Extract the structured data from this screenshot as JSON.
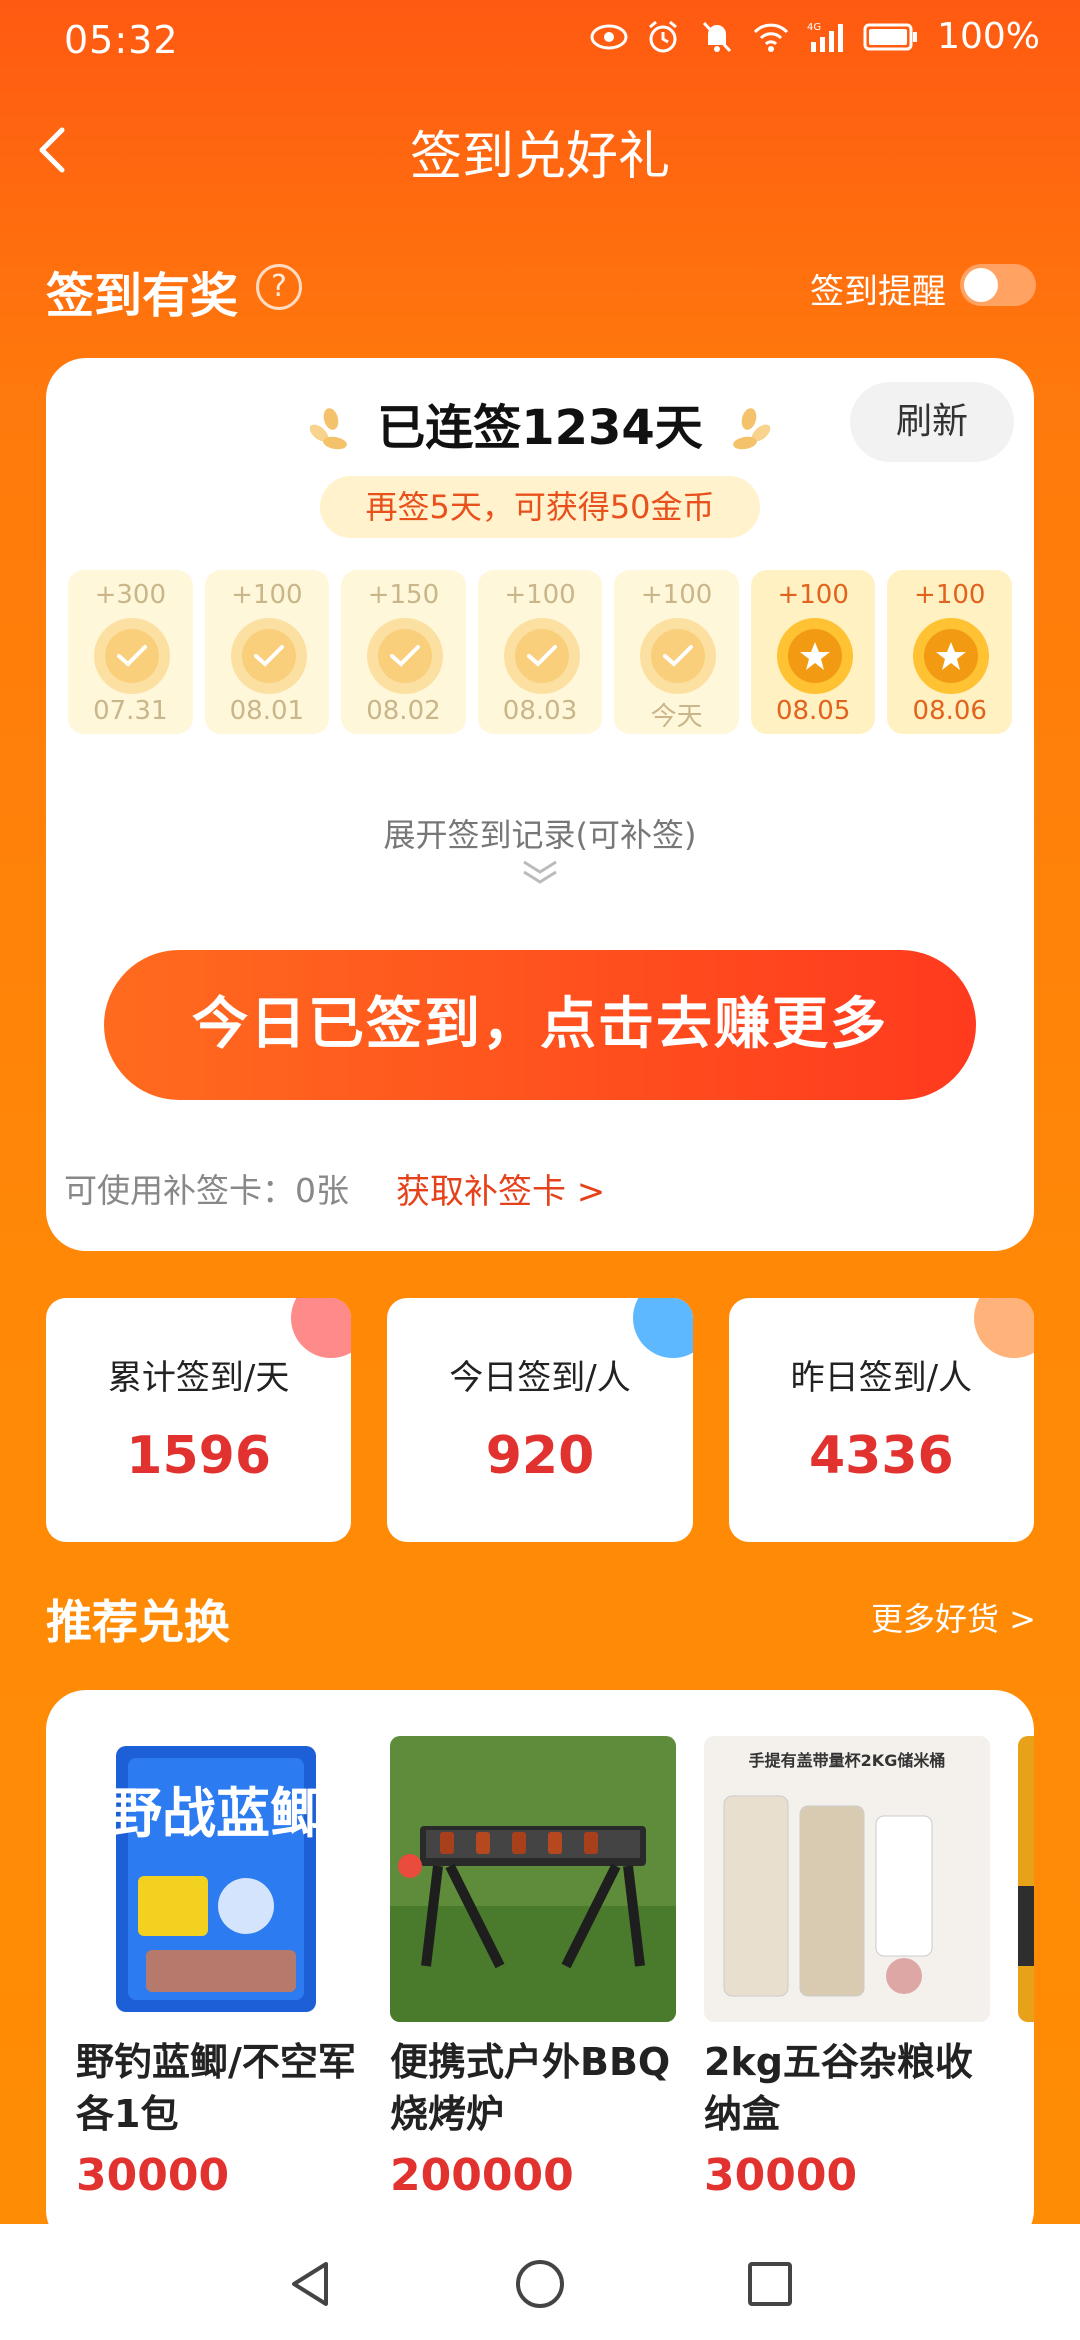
{
  "status_bar": {
    "time": "05:32",
    "battery": "100%",
    "network": "4G"
  },
  "header": {
    "title": "签到兑好礼"
  },
  "signin_section": {
    "title": "签到有奖",
    "help": "?",
    "reminder_label": "签到提醒",
    "reminder_on": false
  },
  "card": {
    "streak_text": "已连签1234天",
    "refresh_label": "刷新",
    "hint": "再签5天，可获得50金币",
    "days": [
      {
        "points": "+300",
        "date": "07.31",
        "state": "signed"
      },
      {
        "points": "+100",
        "date": "08.01",
        "state": "signed"
      },
      {
        "points": "+150",
        "date": "08.02",
        "state": "signed"
      },
      {
        "points": "+100",
        "date": "08.03",
        "state": "signed"
      },
      {
        "points": "+100",
        "date": "今天",
        "state": "signed"
      },
      {
        "points": "+100",
        "date": "08.05",
        "state": "future"
      },
      {
        "points": "+100",
        "date": "08.06",
        "state": "future"
      }
    ],
    "expand_label": "展开签到记录(可补签)",
    "cta_label": "今日已签到，点击去赚更多",
    "makeup_cards": "可使用补签卡：0张",
    "get_makeup_link": "获取补签卡 >"
  },
  "stats": [
    {
      "label": "累计签到/天",
      "value": "1596",
      "accent": "#FF8A8A"
    },
    {
      "label": "今日签到/人",
      "value": "920",
      "accent": "#5DB8FF"
    },
    {
      "label": "昨日签到/人",
      "value": "4336",
      "accent": "#FFB27A"
    }
  ],
  "recommend": {
    "title": "推荐兑换",
    "more_label": "更多好货 >",
    "products": [
      {
        "name": "野钓蓝鲫/不空军各1包",
        "price": "30000",
        "image_text": "野战蓝鲫"
      },
      {
        "name": "便携式户外BBQ烧烤炉",
        "price": "200000"
      },
      {
        "name": "2kg五谷杂粮收纳盒",
        "price": "30000",
        "image_text": "手提有盖带量杯2KG储米桶"
      }
    ]
  },
  "colors": {
    "accent_orange": "#FF7A0C",
    "price_red": "#E2322F",
    "cta_red": "#FF3A1E"
  },
  "icons": [
    "back-icon",
    "eye-icon",
    "alarm-icon",
    "mute-icon",
    "wifi-icon",
    "signal-icon",
    "battery-icon",
    "laurel-icon",
    "check-icon",
    "star-icon",
    "chevron-down-icon",
    "back-nav-icon",
    "home-nav-icon",
    "recents-nav-icon"
  ]
}
